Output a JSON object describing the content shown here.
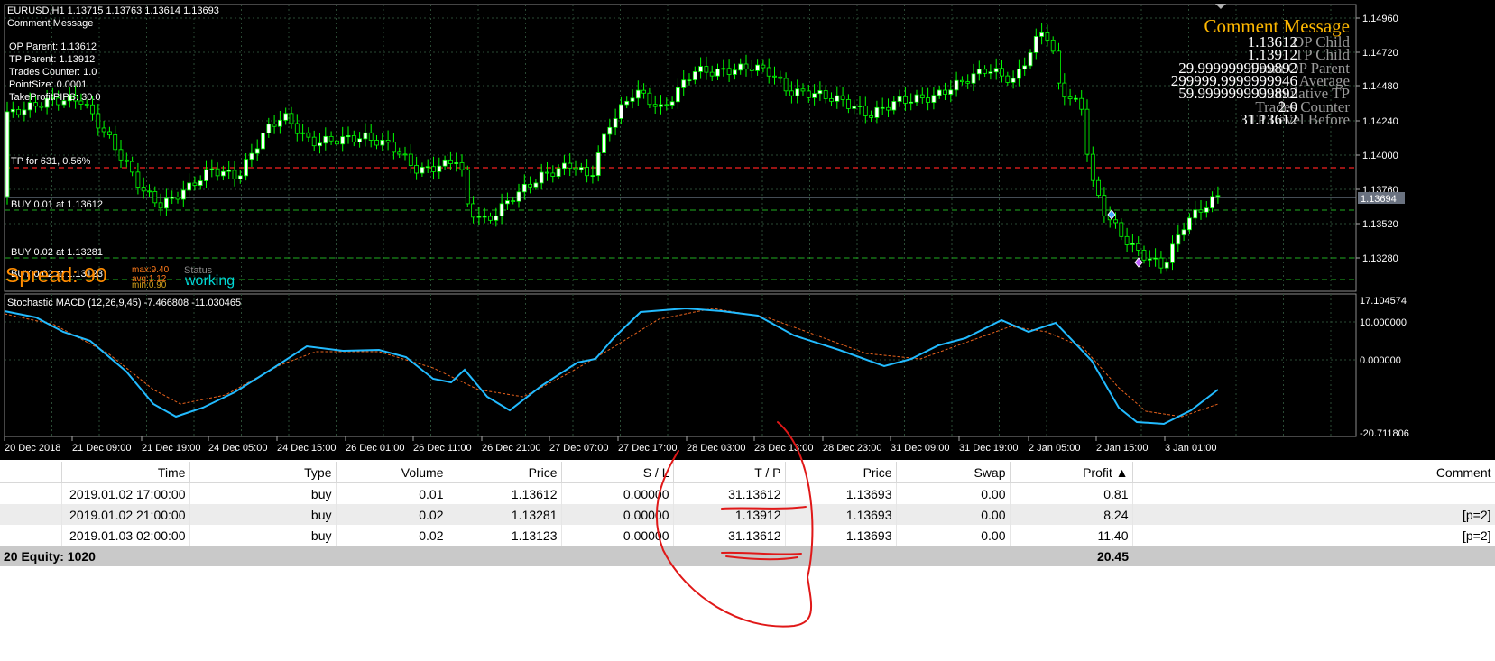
{
  "chart": {
    "info_line": "EURUSD,H1  1.13715 1.13763 1.13614 1.13693",
    "comment_label": "Comment Message",
    "ea_lines": [
      "OP Parent: 1.13612",
      "TP Parent: 1.13912",
      "Trades Counter: 1.0",
      "PointSize: 0.0001",
      "TakeProfitPIPS: 30.0"
    ],
    "level_labels": [
      "TP for 631, 0.56%",
      "BUY 0.01 at 1.13612",
      "BUY 0.02 at 1.13281",
      "BUY 0.02 at 1.13123"
    ],
    "spread": {
      "label": "Spread: 90",
      "max": "max:9.40",
      "avg": "avg:1.12",
      "min": "min:0.90",
      "status_label": "Status",
      "status_value": "working"
    },
    "comment_block": {
      "title": "Comment Message",
      "rows": [
        {
          "value": "1.13612",
          "label": "OP Child"
        },
        {
          "value": "1.13912",
          "label": "TP Child"
        },
        {
          "value": "29.9999999999892",
          "label": "From OP Parent"
        },
        {
          "value": "299999.9999999946",
          "label": "Average"
        },
        {
          "value": "59.9999999999892",
          "label": "Cumulative TP"
        },
        {
          "value": "2.0",
          "label": "Trades Counter"
        },
        {
          "value": "31.13612",
          "label": "TP Level Before"
        }
      ]
    },
    "price_axis": [
      "1.14960",
      "1.14720",
      "1.14480",
      "1.14240",
      "1.14000",
      "1.13760",
      "1.13520",
      "1.13280"
    ],
    "current_price": "1.13694",
    "indicator_label": "Stochastic MACD (12,26,9,45) -7.466808 -11.030465",
    "indicator_axis": [
      "17.104574",
      "10.000000",
      "0.000000",
      "-20.711806"
    ],
    "time_axis": [
      "20 Dec 2018",
      "21 Dec 09:00",
      "21 Dec 19:00",
      "24 Dec 05:00",
      "24 Dec 15:00",
      "26 Dec 01:00",
      "26 Dec 11:00",
      "26 Dec 21:00",
      "27 Dec 07:00",
      "27 Dec 17:00",
      "28 Dec 03:00",
      "28 Dec 13:00",
      "28 Dec 23:00",
      "31 Dec 09:00",
      "31 Dec 19:00",
      "2 Jan 05:00",
      "2 Jan 15:00",
      "3 Jan 01:00"
    ],
    "colors": {
      "bull": "#00ff00",
      "bear": "#00ff00",
      "grid": "#2a4a34",
      "tp_line": "#cc1b1b",
      "buy_line": "#1fae1f",
      "macd": "#22bbff",
      "signal": "#e8621c",
      "spread": "#ff8c00",
      "working": "#00d8d8"
    }
  },
  "terminal": {
    "columns": [
      "",
      "Time",
      "Type",
      "Volume",
      "Price",
      "S / L",
      "T / P",
      "Price",
      "Swap",
      "Profit ▲",
      "Comment"
    ],
    "rows": [
      {
        "ticket": "",
        "time": "2019.01.02 17:00:00",
        "type": "buy",
        "volume": "0.01",
        "price": "1.13612",
        "sl": "0.00000",
        "tp": "31.13612",
        "cur_price": "1.13693",
        "swap": "0.00",
        "profit": "0.81",
        "comment": ""
      },
      {
        "ticket": "",
        "time": "2019.01.02 21:00:00",
        "type": "buy",
        "volume": "0.02",
        "price": "1.13281",
        "sl": "0.00000",
        "tp": "1.13912",
        "cur_price": "1.13693",
        "swap": "0.00",
        "profit": "8.24",
        "comment": "[p=2]"
      },
      {
        "ticket": "",
        "time": "2019.01.03 02:00:00",
        "type": "buy",
        "volume": "0.02",
        "price": "1.13123",
        "sl": "0.00000",
        "tp": "31.13612",
        "cur_price": "1.13693",
        "swap": "0.00",
        "profit": "11.40",
        "comment": "[p=2]"
      }
    ],
    "summary": {
      "left": "20  Equity: 1020",
      "profit": "20.45"
    }
  },
  "annotation_color": "#e01818"
}
